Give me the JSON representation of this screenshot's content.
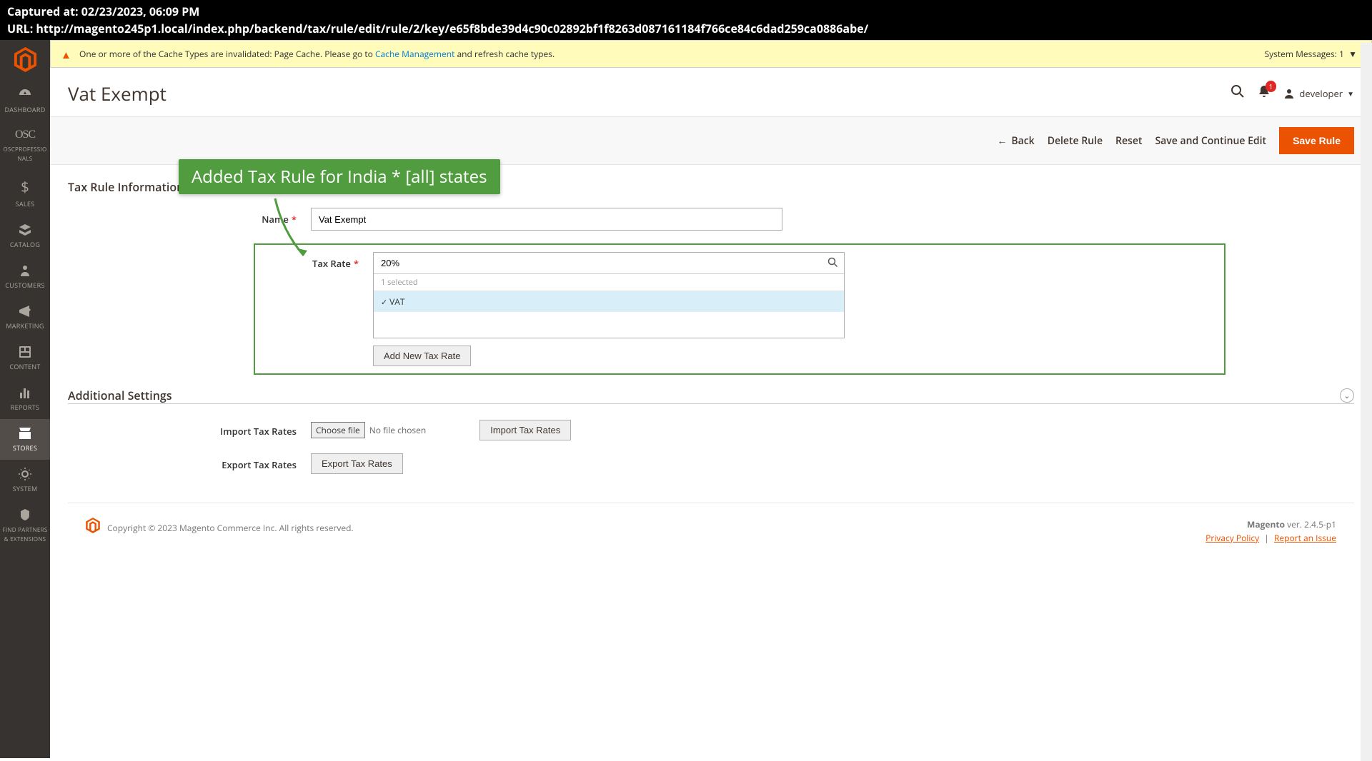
{
  "captured": {
    "line1": "Captured at: 02/23/2023, 06:09 PM",
    "line2": "URL: http://magento245p1.local/index.php/backend/tax/rule/edit/rule/2/key/e65f8bde39d4c90c02892bf1f8263d087161184f766ce84c6dad259ca0886abe/"
  },
  "sidebar": {
    "items": [
      {
        "label": "DASHBOARD",
        "icon": "◉"
      },
      {
        "label": "OSCPROFESSIO\nNALS",
        "icon": "osc"
      },
      {
        "label": "SALES",
        "icon": "$"
      },
      {
        "label": "CATALOG",
        "icon": "◧"
      },
      {
        "label": "CUSTOMERS",
        "icon": "👤"
      },
      {
        "label": "MARKETING",
        "icon": "📢"
      },
      {
        "label": "CONTENT",
        "icon": "▦"
      },
      {
        "label": "REPORTS",
        "icon": "📊"
      },
      {
        "label": "STORES",
        "icon": "🏬"
      },
      {
        "label": "SYSTEM",
        "icon": "⚙"
      },
      {
        "label": "FIND PARTNERS\n& EXTENSIONS",
        "icon": "◈"
      }
    ]
  },
  "system_message": {
    "text_before": "One or more of the Cache Types are invalidated: Page Cache. Please go to ",
    "link": "Cache Management",
    "text_after": " and refresh cache types.",
    "right": "System Messages: 1"
  },
  "header": {
    "title": "Vat Exempt",
    "notif_count": "1",
    "user": "developer"
  },
  "actions": {
    "back": "Back",
    "delete": "Delete Rule",
    "reset": "Reset",
    "save_continue": "Save and Continue Edit",
    "save": "Save Rule"
  },
  "callout": "Added Tax Rule for India * [all] states",
  "section1": {
    "heading": "Tax Rule Information",
    "name_label": "Name",
    "name_value": "Vat Exempt",
    "taxrate_label": "Tax Rate",
    "taxrate_search": "20%",
    "taxrate_count": "1 selected",
    "taxrate_option": "VAT",
    "add_rate": "Add New Tax Rate"
  },
  "section2": {
    "heading": "Additional Settings",
    "import_label": "Import Tax Rates",
    "choose_file": "Choose file",
    "no_file": "No file chosen",
    "import_btn": "Import Tax Rates",
    "export_label": "Export Tax Rates",
    "export_btn": "Export Tax Rates"
  },
  "footer": {
    "copyright": "Copyright © 2023 Magento Commerce Inc. All rights reserved.",
    "magento": "Magento",
    "version": " ver. 2.4.5-p1",
    "privacy": "Privacy Policy",
    "report": "Report an Issue"
  }
}
